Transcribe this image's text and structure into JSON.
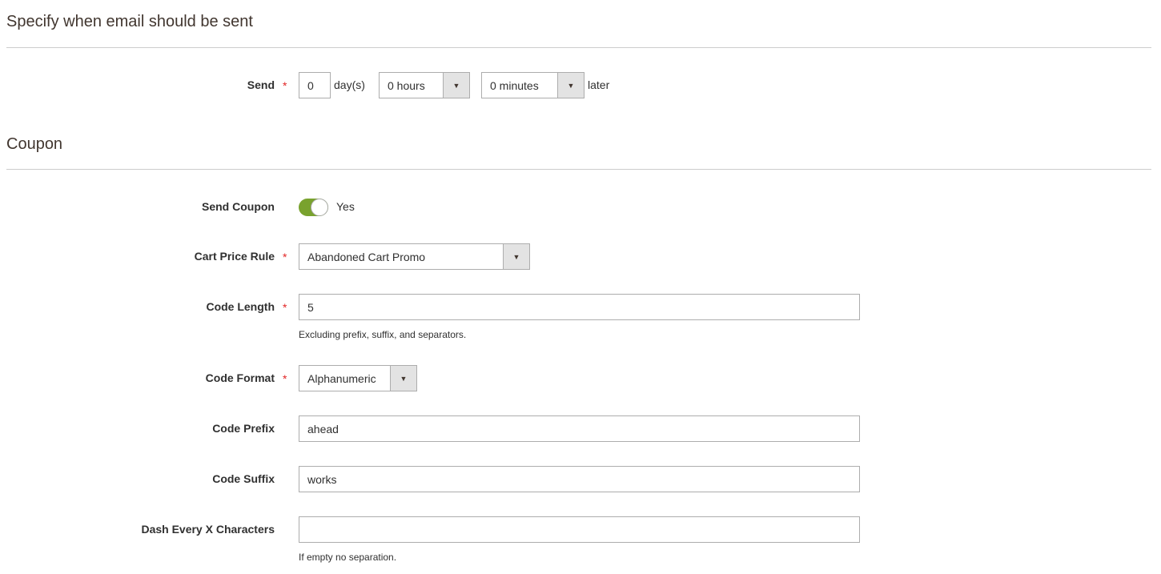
{
  "sections": {
    "schedule": {
      "title": "Specify when email should be sent"
    },
    "coupon": {
      "title": "Coupon"
    }
  },
  "send": {
    "label": "Send",
    "required_mark": "*",
    "days_value": "0",
    "days_unit": "day(s)",
    "hours_selected": "0 hours",
    "minutes_selected": "0 minutes",
    "suffix": "later"
  },
  "coupon": {
    "send_coupon": {
      "label": "Send Coupon",
      "enabled": true,
      "state_label": "Yes"
    },
    "cart_price_rule": {
      "label": "Cart Price Rule",
      "required_mark": "*",
      "selected": "Abandoned Cart Promo"
    },
    "code_length": {
      "label": "Code Length",
      "required_mark": "*",
      "value": "5",
      "note": "Excluding prefix, suffix, and separators."
    },
    "code_format": {
      "label": "Code Format",
      "required_mark": "*",
      "selected": "Alphanumeric"
    },
    "code_prefix": {
      "label": "Code Prefix",
      "value": "ahead"
    },
    "code_suffix": {
      "label": "Code Suffix",
      "value": "works"
    },
    "dash_every": {
      "label": "Dash Every X Characters",
      "value": "",
      "note": "If empty no separation."
    }
  },
  "icons": {
    "dropdown": "▼"
  },
  "colors": {
    "toggle_on": "#79a22e",
    "required": "#e22626"
  }
}
